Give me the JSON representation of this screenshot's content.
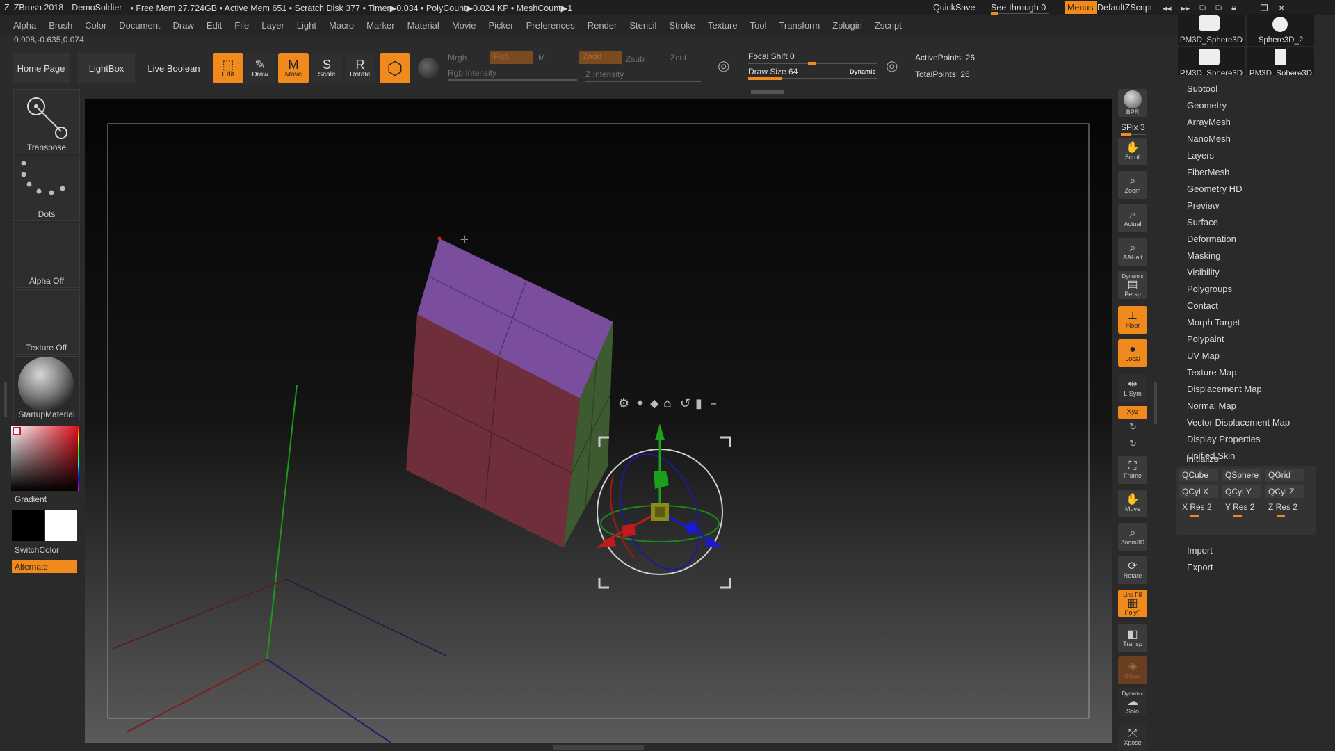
{
  "titlebar": {
    "app": "ZBrush 2018",
    "project": "DemoSoldier",
    "stats": "• Free Mem 27.724GB • Active Mem 651 • Scratch Disk 377 • Timer▶0.034 • PolyCount▶0.024 KP • MeshCount▶1",
    "quicksave": "QuickSave",
    "see_through": "See-through  0",
    "menus": "Menus",
    "script": "DefaultZScript"
  },
  "menubar": [
    "Alpha",
    "Brush",
    "Color",
    "Document",
    "Draw",
    "Edit",
    "File",
    "Layer",
    "Light",
    "Macro",
    "Marker",
    "Material",
    "Movie",
    "Picker",
    "Preferences",
    "Render",
    "Stencil",
    "Stroke",
    "Texture",
    "Tool",
    "Transform",
    "Zplugin",
    "Zscript"
  ],
  "coords": "0.908,-0.635,0.074",
  "toolbar": {
    "home": "Home Page",
    "lightbox": "LightBox",
    "live_boolean": "Live Boolean",
    "edit": "Edit",
    "draw": "Draw",
    "move": "Move",
    "scale": "Scale",
    "rotate": "Rotate",
    "mrgb": "Mrgb",
    "rgb": "Rgb",
    "m": "M",
    "rgb_intensity": "Rgb Intensity",
    "zadd": "Zadd",
    "zsub": "Zsub",
    "zcut": "Zcut",
    "z_intensity": "Z Intensity",
    "focal_shift": "Focal Shift 0",
    "draw_size": "Draw Size 64",
    "dynamic": "Dynamic",
    "active_points": "ActivePoints: 26",
    "total_points": "TotalPoints: 26"
  },
  "left_shelf": {
    "transpose": "Transpose",
    "dots": "Dots",
    "alpha_off": "Alpha Off",
    "texture_off": "Texture Off",
    "material": "StartupMaterial",
    "gradient": "Gradient",
    "switch_color": "SwitchColor",
    "alternate": "Alternate"
  },
  "right_shelf": {
    "bpr": "BPR",
    "spix": "SPix 3",
    "scroll": "Scroll",
    "zoom": "Zoom",
    "actual": "Actual",
    "aahalf": "AAHalf",
    "persp": "Persp",
    "persp_top": "Dynamic",
    "floor": "Floor",
    "local": "Local",
    "lsym": "L.Sym",
    "xyz": "Xyz",
    "frame": "Frame",
    "move": "Move",
    "zoom3d": "Zoom3D",
    "rotate": "Rotate",
    "polyf": "PolyF",
    "polyf_top": "Line Fill",
    "transp": "Transp",
    "ghost": "Ghost",
    "solo": "Solo",
    "solo_top": "Dynamic",
    "xpose": "Xpose"
  },
  "tool_thumbs": [
    "PM3D_Sphere3D",
    "Sphere3D_2",
    "PM3D_Sphere3D",
    "PM3D_Sphere3D"
  ],
  "palette": {
    "items": [
      "Subtool",
      "Geometry",
      "ArrayMesh",
      "NanoMesh",
      "Layers",
      "FiberMesh",
      "Geometry HD",
      "Preview",
      "Surface",
      "Deformation",
      "Masking",
      "Visibility",
      "Polygroups",
      "Contact",
      "Morph Target",
      "Polypaint",
      "UV Map",
      "Texture Map",
      "Displacement Map",
      "Normal Map",
      "Vector Displacement Map",
      "Display Properties",
      "Unified Skin"
    ],
    "initialize": "Initialize",
    "init_buttons": [
      "QCube",
      "QSphere",
      "QGrid",
      "QCyl X",
      "QCyl Y",
      "QCyl Z"
    ],
    "res": [
      "X Res 2",
      "Y Res 2",
      "Z Res 2"
    ],
    "import": "Import",
    "export": "Export"
  },
  "colors": {
    "accent": "#f08a1c",
    "cube_top": "#7a4e9c",
    "cube_left": "#6e2f3a",
    "cube_right": "#3e5a30"
  }
}
